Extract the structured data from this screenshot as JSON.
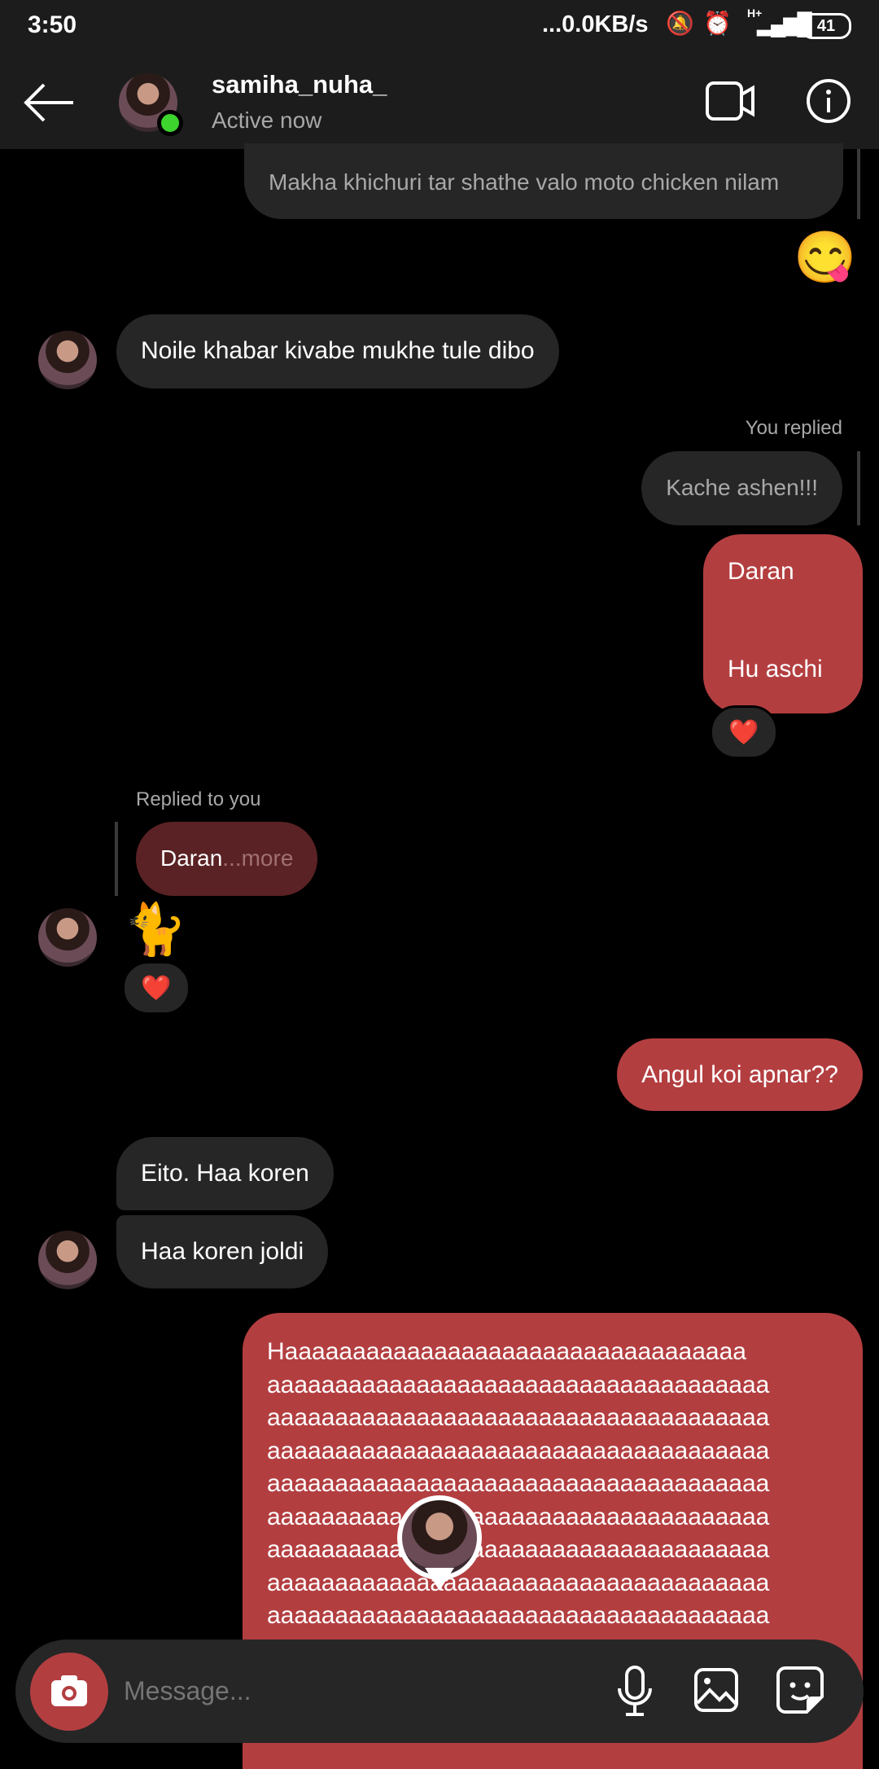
{
  "status": {
    "time": "3:50",
    "net": "...0.0KB/s",
    "signal": "H+",
    "battery": "41"
  },
  "header": {
    "username": "samiha_nuha_",
    "presence": "Active now"
  },
  "messages": {
    "m1": "Makha khichuri tar shathe valo moto chicken nilam",
    "m1_emoji": "😋",
    "m2": "Noile khabar kivabe mukhe tule dibo",
    "you_replied": "You replied",
    "m3": "Kache ashen!!!",
    "m4": "Daran\n\n\nHu aschi",
    "reaction": "❤️",
    "replied_to_you": "Replied to you",
    "quote_text": "Daran",
    "quote_more": "...more",
    "cat": "🐈",
    "m5": "Angul koi apnar??",
    "m6": "Eito. Haa koren",
    "m7": "Haa koren joldi",
    "big_lines": [
      "Haaaaaaaaaaaaaaaaaaaaaaaaaaaaaaaaaa",
      "aaaaaaaaaaaaaaaaaaaaaaaaaaaaaaaaaaaaa",
      "aaaaaaaaaaaaaaaaaaaaaaaaaaaaaaaaaaaaa",
      "aaaaaaaaaaaaaaaaaaaaaaaaaaaaaaaaaaaaa",
      "aaaaaaaaaaaaaaaaaaaaaaaaaaaaaaaaaaaaa",
      "aaaaaaaaaaaaaaaaaaaaaaaaaaaaaaaaaaaaa",
      "aaaaaaaaaaaaaaaaaaaaaaaaaaaaaaaaaaaaa",
      "aaaaaaaaaaaaaaaaaaaaaaaaaaaaaaaaaaaaa",
      "aaaaaaaaaaaaaaaaaaaaaaaaaaaaaaaaaaaaa"
    ]
  },
  "composer": {
    "placeholder": "Message..."
  },
  "colors": {
    "accent": "#b33e40",
    "online": "#3dd42e"
  }
}
